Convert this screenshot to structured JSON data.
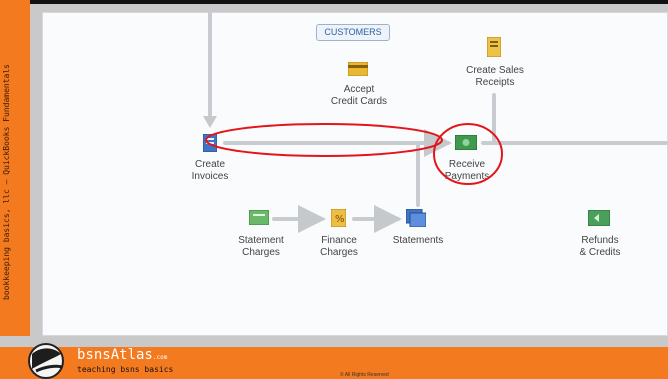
{
  "sidebar": {
    "text": "bookkeeping basics, llc – QuickBooks Fundamentals"
  },
  "header": {
    "tab_label": "CUSTOMERS"
  },
  "workflow": {
    "accept_credit_cards": "Accept\nCredit Cards",
    "create_sales_receipts": "Create Sales\nReceipts",
    "create_invoices": "Create\nInvoices",
    "receive_payments": "Receive\nPayments",
    "statement_charges": "Statement\nCharges",
    "finance_charges": "Finance\nCharges",
    "statements": "Statements",
    "refunds_credits": "Refunds\n& Credits"
  },
  "footer": {
    "brand": "bsnsAtlas",
    "brand_suffix": ".com",
    "tagline": "teaching bsns basics",
    "copyright": "© All Rights Reserved"
  },
  "colors": {
    "orange": "#f47a20",
    "annotation_red": "#e3151a",
    "tab_blue": "#2b62a8"
  }
}
